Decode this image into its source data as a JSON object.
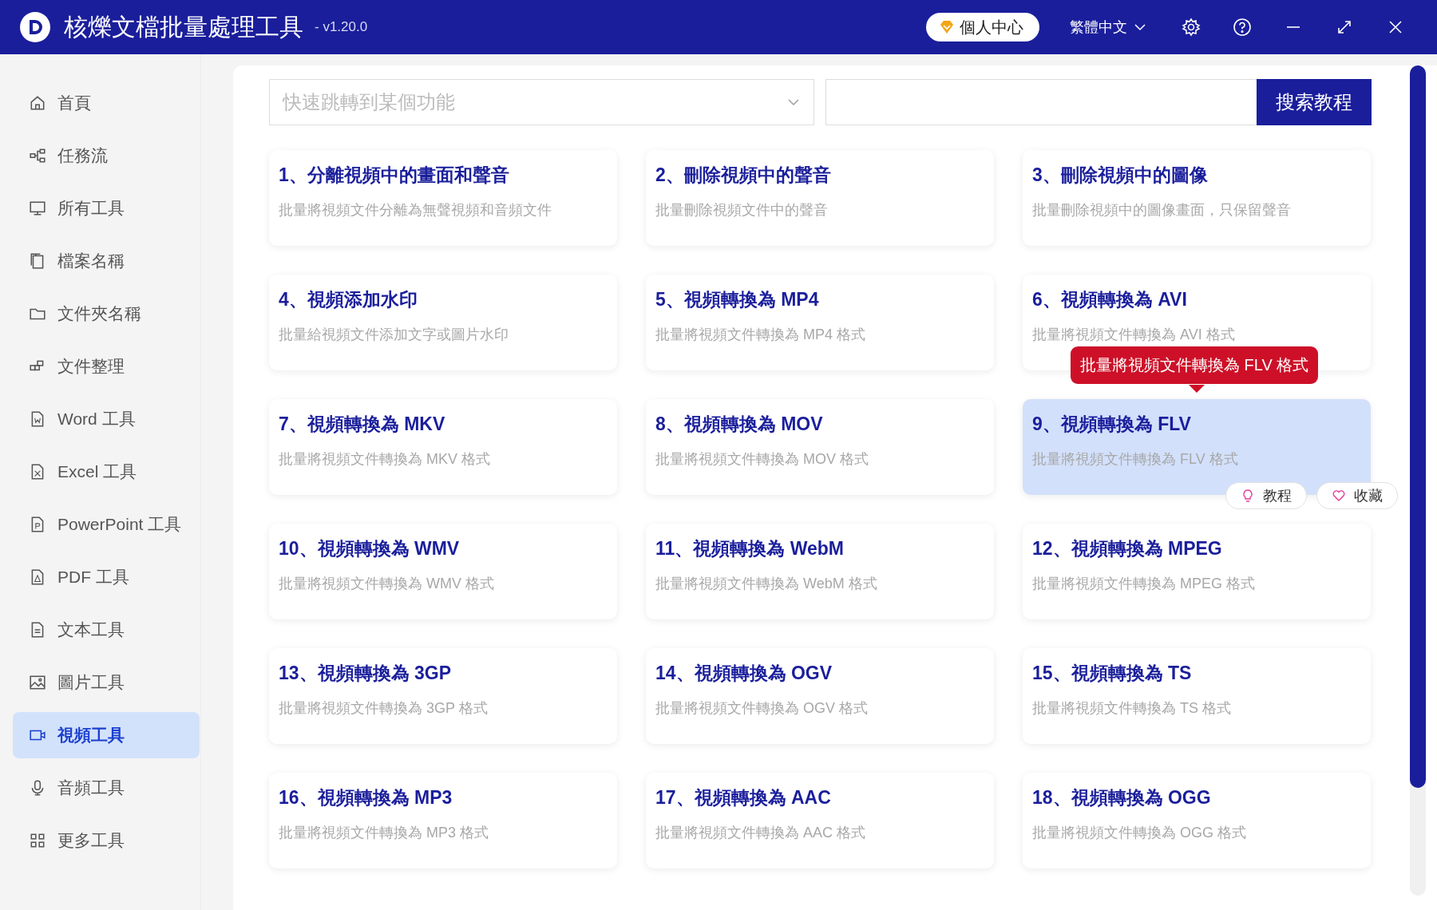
{
  "window": {
    "title": "核爍文檔批量處理工具",
    "version": "- v1.20.0",
    "user_button": "個人中心",
    "language": "繁體中文"
  },
  "sidebar": {
    "items": [
      {
        "label": "首頁",
        "selected": false
      },
      {
        "label": "任務流",
        "selected": false
      },
      {
        "label": "所有工具",
        "selected": false
      },
      {
        "label": "檔案名稱",
        "selected": false
      },
      {
        "label": "文件夾名稱",
        "selected": false
      },
      {
        "label": "文件整理",
        "selected": false
      },
      {
        "label": "Word 工具",
        "selected": false
      },
      {
        "label": "Excel 工具",
        "selected": false
      },
      {
        "label": "PowerPoint 工具",
        "selected": false
      },
      {
        "label": "PDF 工具",
        "selected": false
      },
      {
        "label": "文本工具",
        "selected": false
      },
      {
        "label": "圖片工具",
        "selected": false
      },
      {
        "label": "視頻工具",
        "selected": true
      },
      {
        "label": "音頻工具",
        "selected": false
      },
      {
        "label": "更多工具",
        "selected": false
      }
    ]
  },
  "search": {
    "jump_placeholder": "快速跳轉到某個功能",
    "button": "搜索教程"
  },
  "cards": [
    {
      "title": "1、分離視頻中的畫面和聲音",
      "description": "批量將視頻文件分離為無聲視頻和音頻文件",
      "selected": false
    },
    {
      "title": "2、刪除視頻中的聲音",
      "description": "批量刪除視頻文件中的聲音",
      "selected": false
    },
    {
      "title": "3、刪除視頻中的圖像",
      "description": "批量刪除視頻中的圖像畫面，只保留聲音",
      "selected": false
    },
    {
      "title": "4、視頻添加水印",
      "description": "批量給視頻文件添加文字或圖片水印",
      "selected": false
    },
    {
      "title": "5、視頻轉換為 MP4",
      "description": "批量將視頻文件轉換為 MP4 格式",
      "selected": false
    },
    {
      "title": "6、視頻轉換為 AVI",
      "description": "批量將視頻文件轉換為 AVI 格式",
      "selected": false
    },
    {
      "title": "7、視頻轉換為 MKV",
      "description": "批量將視頻文件轉換為 MKV 格式",
      "selected": false
    },
    {
      "title": "8、視頻轉換為 MOV",
      "description": "批量將視頻文件轉換為 MOV 格式",
      "selected": false
    },
    {
      "title": "9、視頻轉換為 FLV",
      "description": "批量將視頻文件轉換為 FLV 格式",
      "selected": true,
      "actions": [
        "教程",
        "收藏"
      ]
    },
    {
      "title": "10、視頻轉換為 WMV",
      "description": "批量將視頻文件轉換為 WMV 格式",
      "selected": false
    },
    {
      "title": "11、視頻轉換為 WebM",
      "description": "批量將視頻文件轉換為 WebM 格式",
      "selected": false
    },
    {
      "title": "12、視頻轉換為 MPEG",
      "description": "批量將視頻文件轉換為 MPEG 格式",
      "selected": false
    },
    {
      "title": "13、視頻轉換為 3GP",
      "description": "批量將視頻文件轉換為 3GP 格式",
      "selected": false
    },
    {
      "title": "14、視頻轉換為 OGV",
      "description": "批量將視頻文件轉換為 OGV 格式",
      "selected": false
    },
    {
      "title": "15、視頻轉換為 TS",
      "description": "批量將視頻文件轉換為 TS 格式",
      "selected": false
    },
    {
      "title": "16、視頻轉換為 MP3",
      "description": "批量將視頻文件轉換為 MP3 格式",
      "selected": false
    },
    {
      "title": "17、視頻轉換為 AAC",
      "description": "批量將視頻文件轉換為 AAC 格式",
      "selected": false
    },
    {
      "title": "18、視頻轉換為 OGG",
      "description": "批量將視頻文件轉換為 OGG 格式",
      "selected": false
    }
  ],
  "tooltip": "批量將視頻文件轉換為 FLV 格式"
}
